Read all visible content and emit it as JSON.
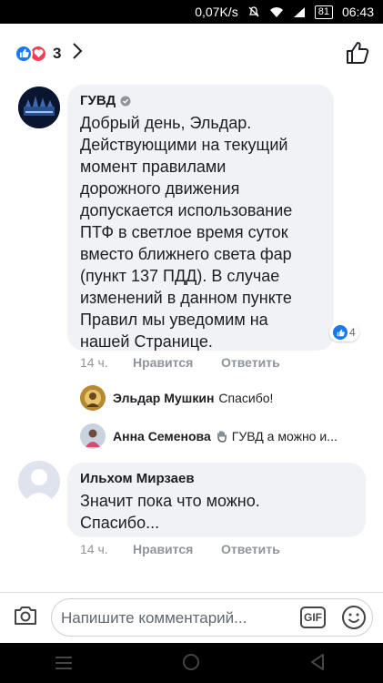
{
  "status_bar": {
    "speed": "0,07K/s",
    "battery": "81",
    "time": "06:43"
  },
  "header": {
    "reaction_count": "3"
  },
  "comments": [
    {
      "author": "ГУВД",
      "verified": true,
      "text_lines": [
        "Добрый день, Эльдар.",
        "Действующими на текущий",
        "момент правилами",
        "дорожного движения",
        "допускается использование",
        "ПТФ в светлое время суток",
        "вместо ближнего света фар",
        "(пункт 137 ПДД). В случае",
        "изменений в данном пункте",
        "Правил мы уведомим на",
        "нашей Странице."
      ],
      "likes": "4",
      "time": "14 ч.",
      "like_label": "Нравится",
      "reply_label": "Ответить"
    },
    {
      "author": "Ильхом Мирзаев",
      "text_lines": [
        "Значит пока что можно.",
        "Спасибо..."
      ],
      "time": "14 ч.",
      "like_label": "Нравится",
      "reply_label": "Ответить"
    }
  ],
  "replies": [
    {
      "author": "Эльдар Мушкин",
      "text": "Спасибо!"
    },
    {
      "author": "Анна Семенова",
      "text": "ГУВД а можно и..."
    }
  ],
  "composer": {
    "placeholder": "Напишите комментарий...",
    "gif_label": "GIF"
  },
  "colors": {
    "accent": "#1877f2",
    "love": "#f33e58",
    "bubble": "#f0f2f5"
  }
}
